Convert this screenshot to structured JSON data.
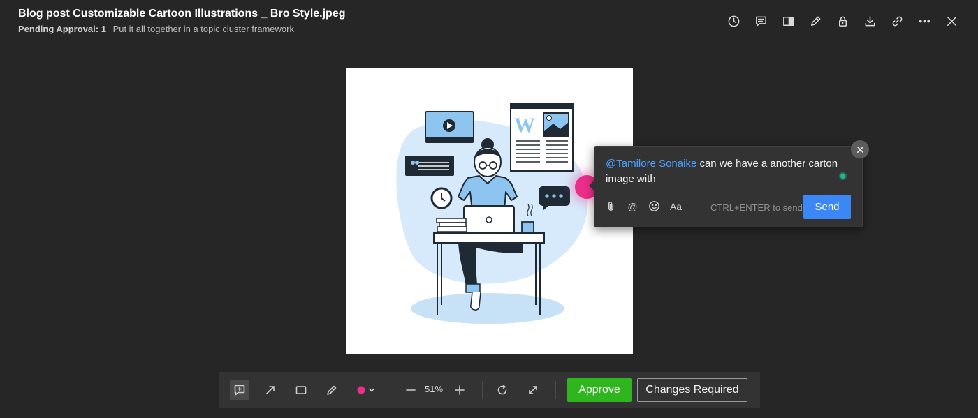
{
  "header": {
    "title": "Blog post Customizable Cartoon Illustrations _ Bro Style.jpeg",
    "pending_label": "Pending Approval:",
    "pending_count": "1",
    "task": "Put it all together in a topic cluster framework"
  },
  "top_icons": [
    "history-icon",
    "comments-icon",
    "compare-icon",
    "edit-icon",
    "lock-icon",
    "download-icon",
    "link-icon",
    "more-icon",
    "close-icon"
  ],
  "comment": {
    "mention": "@Tamilore Sonaike",
    "text": " can we have a another carton image with",
    "hint": "CTRL+ENTER to send",
    "send_label": "Send",
    "format_label": "Aa",
    "at_label": "@"
  },
  "toolbar": {
    "zoom": "51%",
    "approve_label": "Approve",
    "changes_label": "Changes Required",
    "color": "#ec2d8a"
  },
  "colors": {
    "accent_blue": "#3b87f5",
    "approve_green": "#2fb51e",
    "pin_pink": "#ec2d8a",
    "illustration_blue": "#8ec5f0"
  }
}
